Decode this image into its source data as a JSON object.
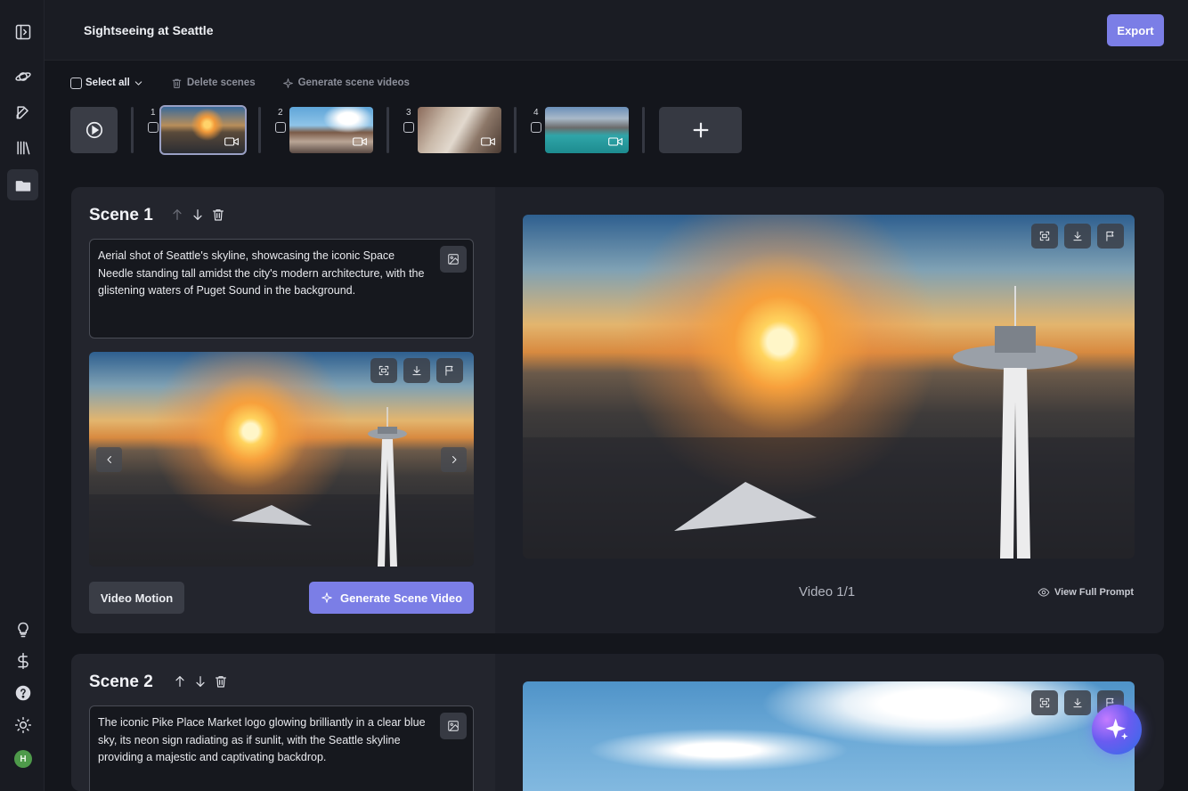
{
  "header": {
    "title": "Sightseeing at Seattle",
    "export_label": "Export"
  },
  "toolbar": {
    "select_all": "Select all",
    "delete_scenes": "Delete scenes",
    "generate_videos": "Generate scene videos"
  },
  "strip": {
    "thumbs": [
      {
        "num": "1"
      },
      {
        "num": "2"
      },
      {
        "num": "3"
      },
      {
        "num": "4"
      }
    ]
  },
  "scenes": [
    {
      "title": "Scene 1",
      "prompt": "Aerial shot of Seattle's skyline, showcasing the iconic Space Needle standing tall amidst the city's modern architecture, with the glistening waters of Puget Sound in the background.",
      "motion_label": "Video Motion",
      "generate_label": "Generate Scene Video",
      "video_label": "Video 1/1",
      "view_prompt_label": "View Full Prompt"
    },
    {
      "title": "Scene 2",
      "prompt": "The iconic Pike Place Market logo glowing brilliantly in a clear blue sky, its neon sign radiating as if sunlit, with the Seattle skyline providing a majestic and captivating backdrop."
    }
  ],
  "sidebar": {
    "avatar_initial": "H"
  },
  "colors": {
    "accent": "#7b7ee6",
    "background": "#14161c",
    "panel": "#1e2028"
  }
}
